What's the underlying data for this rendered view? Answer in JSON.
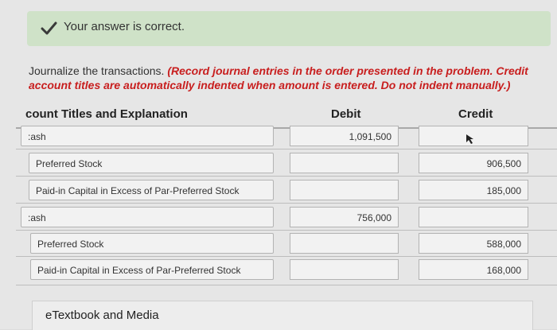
{
  "banner": {
    "message": "Your answer is correct.",
    "icon": "check-icon"
  },
  "instructions": {
    "text": "Journalize the transactions. ",
    "note": "(Record journal entries in the order presented in the problem. Credit account titles are automatically indented when amount is entered. Do not indent manually.)"
  },
  "table": {
    "headers": {
      "title": "count Titles and Explanation",
      "debit": "Debit",
      "credit": "Credit"
    },
    "rows": [
      {
        "account": ":ash",
        "debit": "1,091,500",
        "credit": ""
      },
      {
        "account": "Preferred Stock",
        "debit": "",
        "credit": "906,500"
      },
      {
        "account": "Paid-in Capital in Excess of Par-Preferred Stock",
        "debit": "",
        "credit": "185,000"
      },
      {
        "account": ":ash",
        "debit": "756,000",
        "credit": ""
      },
      {
        "account": "Preferred Stock",
        "debit": "",
        "credit": "588,000"
      },
      {
        "account": "Paid-in Capital in Excess of Par-Preferred Stock",
        "debit": "",
        "credit": "168,000"
      }
    ]
  },
  "etextbook": {
    "label": "eTextbook and Media"
  }
}
